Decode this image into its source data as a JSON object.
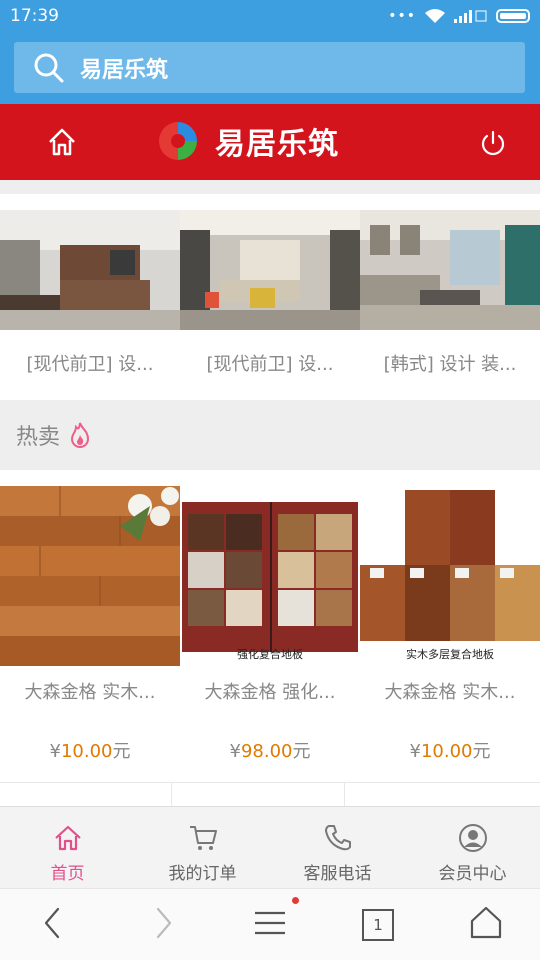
{
  "status_bar": {
    "time": "17:39",
    "dots": "•••"
  },
  "search": {
    "text": "易居乐筑"
  },
  "header": {
    "logo_text": "易居乐筑"
  },
  "designs": [
    {
      "title": "[现代前卫] 设..."
    },
    {
      "title": "[现代前卫] 设..."
    },
    {
      "title": "[韩式] 设计 装..."
    }
  ],
  "hot": {
    "label": "热卖"
  },
  "products": [
    {
      "name": "大森金格 实木...",
      "price_prefix": "¥",
      "price": "10.00",
      "price_unit": "元",
      "caption": ""
    },
    {
      "name": "大森金格 强化...",
      "price_prefix": "¥",
      "price": "98.00",
      "price_unit": "元",
      "caption": "强化复合地板"
    },
    {
      "name": "大森金格 实木...",
      "price_prefix": "¥",
      "price": "10.00",
      "price_unit": "元",
      "caption": "实木多层复合地板"
    }
  ],
  "tabs": [
    {
      "label": "首页",
      "icon": "home-icon",
      "active": true
    },
    {
      "label": "我的订单",
      "icon": "cart-icon",
      "active": false
    },
    {
      "label": "客服电话",
      "icon": "phone-icon",
      "active": false
    },
    {
      "label": "会员中心",
      "icon": "user-icon",
      "active": false
    }
  ],
  "nav": {
    "tab_count": "1"
  },
  "colors": {
    "brand_blue": "#3d9fe0",
    "brand_red": "#d4141c",
    "accent_pink": "#e0508a",
    "price_orange": "#e07a00"
  }
}
